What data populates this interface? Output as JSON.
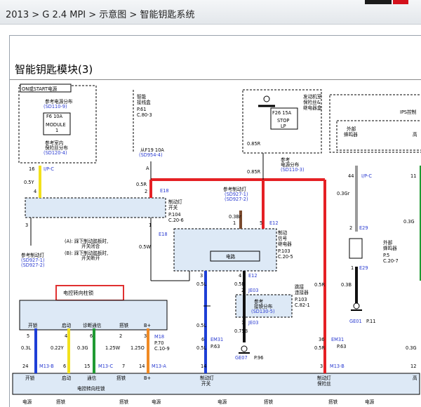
{
  "header": {
    "breadcrumb": "2013 > G 2.4 MPI > 示意图 > 智能钥匙系统"
  },
  "page": {
    "title": "智能钥匙模块(3)"
  },
  "diagram": {
    "labels": {
      "on_start": "ON或START电源",
      "ref_power1": "参考电源分布",
      "ref_power1_code": "(SD110-9)",
      "f6": "F6 10A",
      "module": "MODULE",
      "module_n": "1",
      "ref_room1": "参考室内",
      "ref_room2": "保险丝分布",
      "ref_room_code": "(SD120-4)",
      "jb1": "智能",
      "jb2": "接线盒",
      "jb_p": "P.61",
      "jb_c": "C.80-3",
      "from_f19": "从F19 10A",
      "from_f19_code": "(SD954-4)",
      "a_mark": "A",
      "eng1": "发动机室",
      "eng2": "保险丝&",
      "eng3": "继电器盒",
      "f26": "F26 15A",
      "stop": "STOP",
      "lp": "LP",
      "ips": "IPS控制",
      "ext1": "外部",
      "ext2": "蜂鸣器",
      "high": "高",
      "w_085r_a": "0.85R",
      "w_085r_b": "0.85R",
      "ref_pd": "参考",
      "ref_pd2": "电源分布",
      "ref_pd_code": "(SD110-3)",
      "pin16": "16",
      "ipc": "I/P-C",
      "w05y": "0.5Y",
      "pin4a": "4",
      "pin44": "44",
      "ipc2": "I/P-C",
      "pin11": "11",
      "w05r": "0.5R",
      "pin2": "2",
      "e18": "E18",
      "w03gr": "0.3Gr",
      "w03g_r": "0.3G",
      "ref_lamp": "参考制动灯",
      "ref_lamp_c1": "(SD927-1)",
      "ref_lamp_c2": "(SD927-2)",
      "w03br": "0.3Br",
      "pin1a": "1",
      "pin5": "5",
      "e12": "E12",
      "bsw1": "制动灯",
      "bsw2": "开关",
      "bsw_p": "P.104",
      "bsw_c": "C.20-6",
      "pin3a": "3",
      "pin1b": "1",
      "e18b": "E18",
      "note_a": "(A): 踩下制动踏板时,",
      "note_a2": "开关闭合",
      "note_b": "(B): 踩下制动踏板时,",
      "note_b2": "开关断开",
      "w05w": "0.5W",
      "sig1": "制动",
      "sig2": "信号",
      "sig3": "继电器",
      "sig_p": "P.103",
      "sig_c": "C.20-5",
      "circuit": "电路",
      "pin2e29": "2",
      "e29": "E29",
      "buz1": "外部",
      "buz2": "蜂鸣器",
      "buz_p": "P.5",
      "buz_c": "C.20-7",
      "pin1e29": "1",
      "e29b": "E29",
      "ref_lamp2": "参考制动灯",
      "ref_lamp2_c1": "(SD927-1)",
      "ref_lamp2_c2": "(SD927-2)",
      "pin3b": "3",
      "pin4b": "4",
      "e12b": "E12",
      "w05l_a": "0.5L",
      "w05b": "0.5B",
      "pin2b": "2",
      "je03": "JE03",
      "w05r_b": "0.5R",
      "w03b": "0.3B",
      "ge01": "GE01",
      "ge01_p": "P.11",
      "esl": "电控转向柱锁",
      "jc1": "跳接",
      "jc2": "连接器",
      "jc_p": "P.103",
      "jc_c": "C.82-1",
      "ref_jc1": "参考",
      "ref_jc2": "接铁分布",
      "ref_jc_code": "(SD130-5)",
      "pin1c": "1",
      "je03b": "JE03",
      "w05l_b": "0.5L",
      "w075b": "0.75B",
      "h_unlock": "开锁",
      "h_start": "启动",
      "h_diag": "诊断通信",
      "h_lock": "搭铁",
      "h_bplus": "B+",
      "p5": "5",
      "p4": "4",
      "p6": "6",
      "p2": "2",
      "p3": "3",
      "m18": "M18",
      "m18_p": "P.70",
      "m18_c": "C.10-9",
      "pin6": "6",
      "em31": "EM31",
      "em31_p": "P.63",
      "ge07": "GE07",
      "ge07_p": "P.96",
      "pin36": "36",
      "em31b": "EM31",
      "em31b_p": "P.63",
      "w03l": "0.3L",
      "w022y": "0.22Y",
      "w03g": "0.3G",
      "w125w": "1.25W",
      "w125o": "1.25O",
      "w05l_c": "0.5L",
      "w05r_c": "0.5R",
      "w03g_b": "0.3G",
      "pin24": "24",
      "m13b": "M13-B",
      "pin6b": "6",
      "pin15": "15",
      "m13c": "M13-C",
      "pin7": "7",
      "pin14": "14",
      "m13a": "M13-A",
      "pin14b": "14",
      "pin3c": "3",
      "m13b2": "M13-B",
      "pin12": "12",
      "b_unlock": "开锁",
      "b_start": "启动",
      "b_comm": "通信",
      "b_lock": "搭铁",
      "b_bplus": "B+",
      "b_esl": "电控转向柱锁",
      "b_bsw1": "制动灯",
      "b_bsw2": "开关",
      "b_brk1": "制动灯",
      "b_brk2": "保险丝",
      "b_high": "高",
      "f_power": "电源",
      "f_gnd": "搭铁",
      "f_gnd2": "搭铁",
      "f_power2": "电源",
      "f_power3": "电源",
      "f_gnd3": "搭铁",
      "f_gnd4": "搭铁",
      "f_power4": "电源"
    }
  }
}
